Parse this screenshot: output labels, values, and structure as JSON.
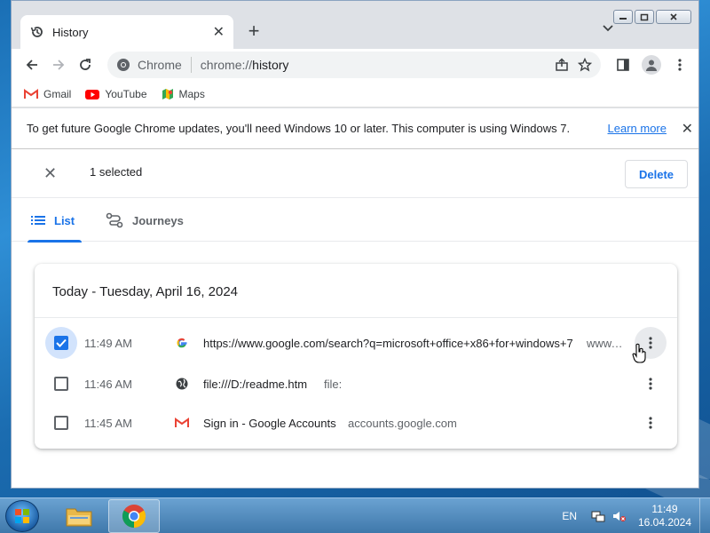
{
  "window": {
    "tab_title": "History",
    "new_tab_symbol": "+"
  },
  "toolbar": {
    "omnibox_site": "Chrome",
    "omnibox_scheme": "chrome://",
    "omnibox_path": "history"
  },
  "bookmarks": [
    {
      "label": "Gmail",
      "icon": "gmail-icon"
    },
    {
      "label": "YouTube",
      "icon": "youtube-icon"
    },
    {
      "label": "Maps",
      "icon": "maps-icon"
    }
  ],
  "infobar": {
    "message": "To get future Google Chrome updates, you'll need Windows 10 or later. This computer is using Windows 7.",
    "link": "Learn more"
  },
  "selection": {
    "count_text": "1 selected",
    "delete_label": "Delete"
  },
  "tabs": [
    {
      "label": "List",
      "active": true
    },
    {
      "label": "Journeys",
      "active": false
    }
  ],
  "history": {
    "date_header": "Today - Tuesday, April 16, 2024",
    "items": [
      {
        "time": "11:49 AM",
        "title": "https://www.google.com/search?q=microsoft+office+x86+for+windows+7",
        "domain": "www.google.com",
        "checked": true,
        "favicon": "google-icon"
      },
      {
        "time": "11:46 AM",
        "title": "file:///D:/readme.htm",
        "domain": "file:",
        "checked": false,
        "favicon": "globe-icon"
      },
      {
        "time": "11:45 AM",
        "title": "Sign in - Google Accounts",
        "domain": "accounts.google.com",
        "checked": false,
        "favicon": "gmail-icon"
      }
    ]
  },
  "taskbar": {
    "lang": "EN",
    "time": "11:49",
    "date": "16.04.2024"
  },
  "colors": {
    "accent": "#1a73e8",
    "taskbar": "#3f78ab",
    "desktop": "#1b6cb0"
  }
}
